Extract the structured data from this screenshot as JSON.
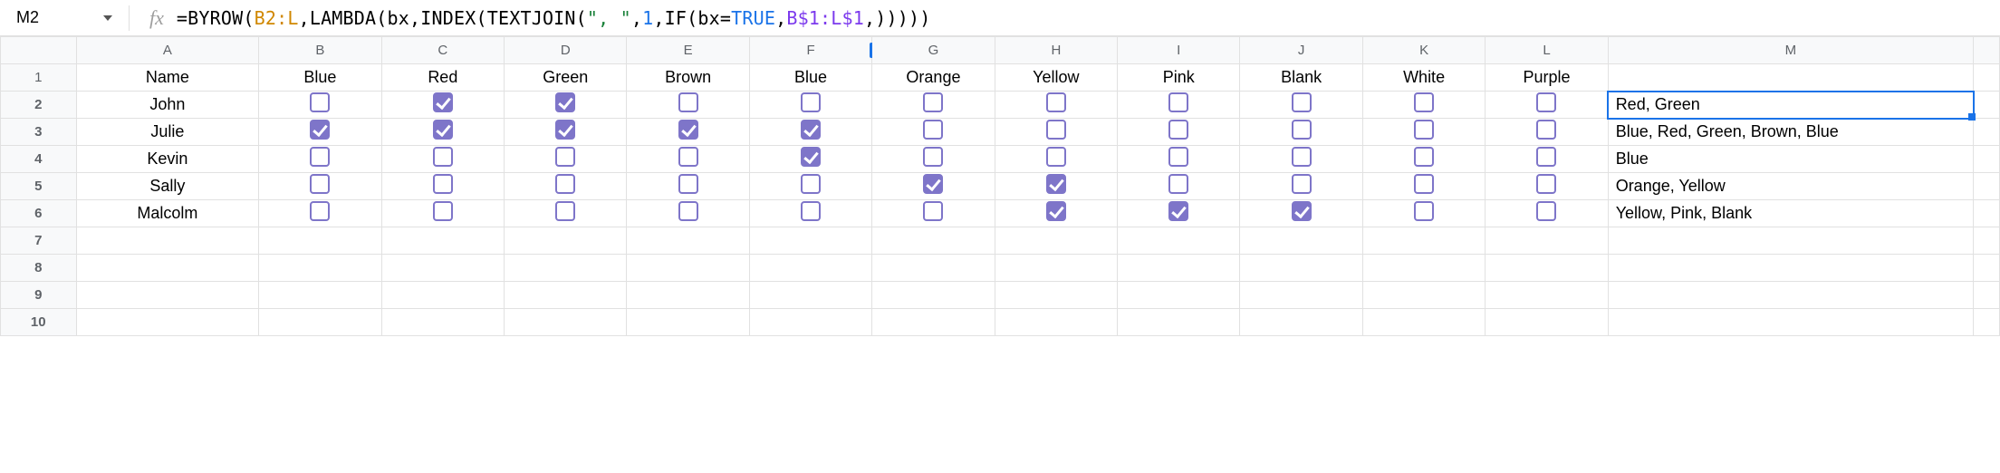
{
  "name_box": {
    "value": "M2"
  },
  "formula": {
    "prefix": "=",
    "tokens": [
      {
        "cls": "tok-fn",
        "text": "BYROW"
      },
      {
        "cls": "tok-punct",
        "text": "("
      },
      {
        "cls": "tok-ref1",
        "text": "B2:L"
      },
      {
        "cls": "tok-punct",
        "text": ","
      },
      {
        "cls": "tok-fn",
        "text": "LAMBDA"
      },
      {
        "cls": "tok-punct",
        "text": "("
      },
      {
        "cls": "tok-fn",
        "text": "bx"
      },
      {
        "cls": "tok-punct",
        "text": ","
      },
      {
        "cls": "tok-fn",
        "text": "INDEX"
      },
      {
        "cls": "tok-punct",
        "text": "("
      },
      {
        "cls": "tok-fn",
        "text": "TEXTJOIN"
      },
      {
        "cls": "tok-punct",
        "text": "("
      },
      {
        "cls": "tok-str",
        "text": "\", \""
      },
      {
        "cls": "tok-punct",
        "text": ","
      },
      {
        "cls": "tok-num",
        "text": "1"
      },
      {
        "cls": "tok-punct",
        "text": ","
      },
      {
        "cls": "tok-fn",
        "text": "IF"
      },
      {
        "cls": "tok-punct",
        "text": "("
      },
      {
        "cls": "tok-fn",
        "text": "bx"
      },
      {
        "cls": "tok-punct",
        "text": "="
      },
      {
        "cls": "tok-true",
        "text": "TRUE"
      },
      {
        "cls": "tok-punct",
        "text": ","
      },
      {
        "cls": "tok-ref2",
        "text": "B$1:L$1"
      },
      {
        "cls": "tok-punct",
        "text": ","
      },
      {
        "cls": "tok-punct",
        "text": ")))))"
      }
    ]
  },
  "columns": {
    "letters": [
      "A",
      "B",
      "C",
      "D",
      "E",
      "F",
      "G",
      "H",
      "I",
      "J",
      "K",
      "L",
      "M",
      ""
    ],
    "headers": {
      "A": "Name",
      "B": "Blue",
      "C": "Red",
      "D": "Green",
      "E": "Brown",
      "F": "Blue",
      "G": "Orange",
      "H": "Yellow",
      "I": "Pink",
      "J": "Blank",
      "K": "White",
      "L": "Purple"
    }
  },
  "rows": [
    {
      "num": 2,
      "name": "John",
      "checks": [
        false,
        true,
        true,
        false,
        false,
        false,
        false,
        false,
        false,
        false,
        false
      ],
      "result": "Red, Green"
    },
    {
      "num": 3,
      "name": "Julie",
      "checks": [
        true,
        true,
        true,
        true,
        true,
        false,
        false,
        false,
        false,
        false,
        false
      ],
      "result": "Blue, Red, Green, Brown, Blue"
    },
    {
      "num": 4,
      "name": "Kevin",
      "checks": [
        false,
        false,
        false,
        false,
        true,
        false,
        false,
        false,
        false,
        false,
        false
      ],
      "result": "Blue"
    },
    {
      "num": 5,
      "name": "Sally",
      "checks": [
        false,
        false,
        false,
        false,
        false,
        true,
        true,
        false,
        false,
        false,
        false
      ],
      "result": "Orange, Yellow"
    },
    {
      "num": 6,
      "name": "Malcolm",
      "checks": [
        false,
        false,
        false,
        false,
        false,
        false,
        true,
        true,
        true,
        false,
        false
      ],
      "result": "Yellow, Pink, Blank"
    }
  ],
  "empty_rows": [
    7,
    8,
    9,
    10
  ]
}
